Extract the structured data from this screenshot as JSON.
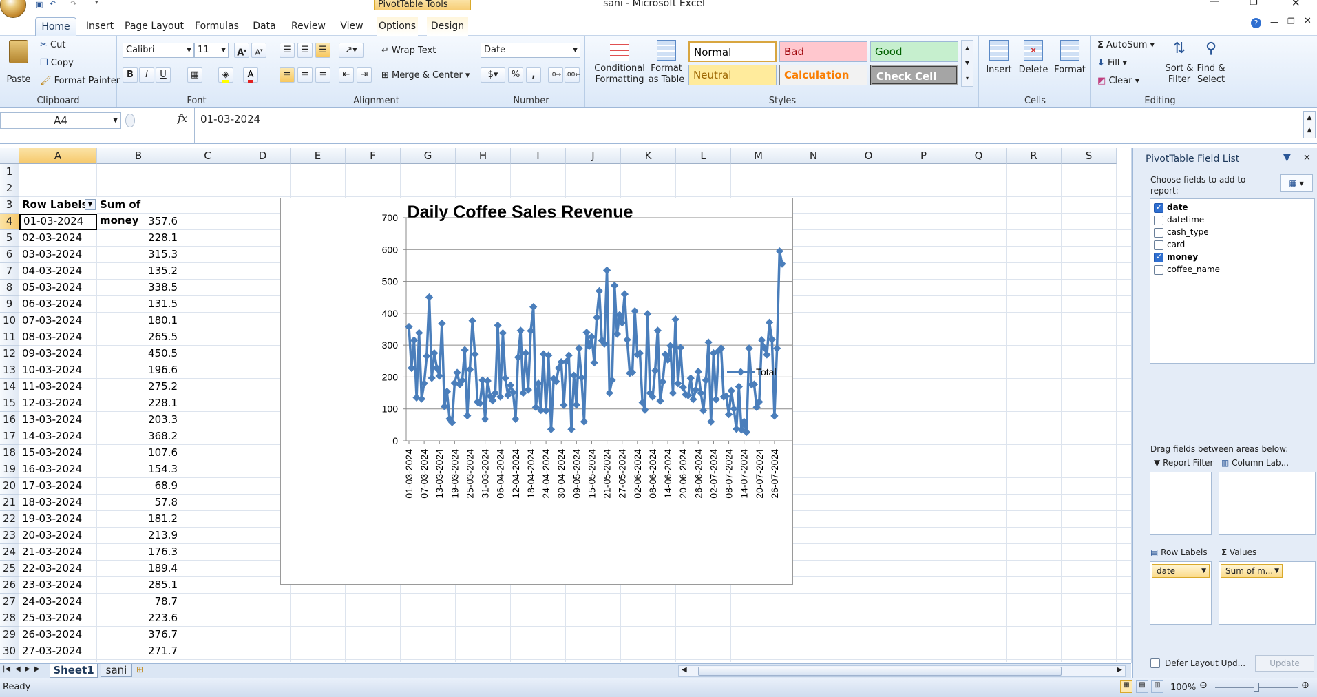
{
  "window": {
    "title": "sani - Microsoft Excel",
    "context_tab": "PivotTable Tools"
  },
  "ribbon": {
    "tabs": [
      "Home",
      "Insert",
      "Page Layout",
      "Formulas",
      "Data",
      "Review",
      "View",
      "Options",
      "Design"
    ],
    "active_tab": "Home",
    "clipboard": {
      "paste": "Paste",
      "cut": "Cut",
      "copy": "Copy",
      "format_painter": "Format Painter",
      "label": "Clipboard"
    },
    "font": {
      "name": "Calibri",
      "size": "11",
      "label": "Font",
      "bold": "B",
      "italic": "I",
      "underline": "U"
    },
    "alignment": {
      "wrap": "Wrap Text",
      "merge": "Merge & Center",
      "label": "Alignment"
    },
    "number": {
      "format": "Date",
      "label": "Number",
      "percent": "%",
      "comma": ","
    },
    "styles": {
      "conditional": "Conditional Formatting",
      "format_as_table": "Format as Table",
      "label": "Styles",
      "cells": [
        {
          "name": "Normal",
          "bg": "#ffffff",
          "fg": "#000000",
          "border": "#d8a640"
        },
        {
          "name": "Bad",
          "bg": "#ffc7ce",
          "fg": "#9c0006",
          "border": "#ffc7ce"
        },
        {
          "name": "Good",
          "bg": "#c6efce",
          "fg": "#006100",
          "border": "#c6efce"
        },
        {
          "name": "Neutral",
          "bg": "#ffeb9c",
          "fg": "#9c6500",
          "border": "#ffeb9c"
        },
        {
          "name": "Calculation",
          "bg": "#f2f2f2",
          "fg": "#fa7d00",
          "border": "#7f7f7f"
        },
        {
          "name": "Check Cell",
          "bg": "#a5a5a5",
          "fg": "#ffffff",
          "border": "#3f3f3f"
        }
      ]
    },
    "cells": {
      "insert": "Insert",
      "delete": "Delete",
      "format": "Format",
      "label": "Cells"
    },
    "editing": {
      "autosum": "AutoSum",
      "fill": "Fill",
      "clear": "Clear",
      "sort": "Sort & Filter",
      "find": "Find & Select",
      "label": "Editing"
    }
  },
  "formula_bar": {
    "name_box": "A4",
    "fx": "fx",
    "value": "01-03-2024"
  },
  "grid": {
    "columns": [
      "A",
      "B",
      "C",
      "D",
      "E",
      "F",
      "G",
      "H",
      "I",
      "J",
      "K",
      "L",
      "M",
      "N",
      "O",
      "P",
      "Q",
      "R",
      "S"
    ],
    "header_a": "Row Labels",
    "header_b": "Sum of money",
    "rows": [
      [
        "01-03-2024",
        "357.6"
      ],
      [
        "02-03-2024",
        "228.1"
      ],
      [
        "03-03-2024",
        "315.3"
      ],
      [
        "04-03-2024",
        "135.2"
      ],
      [
        "05-03-2024",
        "338.5"
      ],
      [
        "06-03-2024",
        "131.5"
      ],
      [
        "07-03-2024",
        "180.1"
      ],
      [
        "08-03-2024",
        "265.5"
      ],
      [
        "09-03-2024",
        "450.5"
      ],
      [
        "10-03-2024",
        "196.6"
      ],
      [
        "11-03-2024",
        "275.2"
      ],
      [
        "12-03-2024",
        "228.1"
      ],
      [
        "13-03-2024",
        "203.3"
      ],
      [
        "14-03-2024",
        "368.2"
      ],
      [
        "15-03-2024",
        "107.6"
      ],
      [
        "16-03-2024",
        "154.3"
      ],
      [
        "17-03-2024",
        "68.9"
      ],
      [
        "18-03-2024",
        "57.8"
      ],
      [
        "19-03-2024",
        "181.2"
      ],
      [
        "20-03-2024",
        "213.9"
      ],
      [
        "21-03-2024",
        "176.3"
      ],
      [
        "22-03-2024",
        "189.4"
      ],
      [
        "23-03-2024",
        "285.1"
      ],
      [
        "24-03-2024",
        "78.7"
      ],
      [
        "25-03-2024",
        "223.6"
      ],
      [
        "26-03-2024",
        "376.7"
      ],
      [
        "27-03-2024",
        "271.7"
      ]
    ]
  },
  "chart_data": {
    "type": "line",
    "title": "Daily Coffee Sales Revenue",
    "series": [
      {
        "name": "Total",
        "color": "#4a7ebb",
        "values": [
          357.6,
          228.1,
          315.3,
          135.2,
          338.5,
          131.5,
          180.1,
          265.5,
          450.5,
          196.6,
          275.2,
          228.1,
          203.3,
          368.2,
          107.6,
          154.3,
          68.9,
          57.8,
          181.2,
          213.9,
          176.3,
          189.4,
          285.1,
          78.7,
          223.6,
          376.7,
          271.7,
          122,
          118,
          190,
          68,
          188,
          140,
          126,
          150,
          362,
          138,
          338,
          196,
          143,
          174,
          152,
          68,
          262,
          346,
          150,
          275,
          160,
          345,
          420,
          105,
          180,
          96,
          272,
          95,
          268,
          36,
          195,
          186,
          228,
          247,
          112,
          248,
          268,
          36,
          205,
          113,
          290,
          198,
          60,
          340,
          297,
          326,
          245,
          387,
          470,
          315,
          304,
          535,
          150,
          190,
          487,
          335,
          395,
          370,
          460,
          317,
          212,
          215,
          407,
          270,
          275,
          120,
          97,
          398,
          150,
          138,
          220,
          346,
          125,
          185,
          271,
          254,
          298,
          150,
          381,
          180,
          292,
          168,
          145,
          142,
          196,
          130,
          160,
          217,
          150,
          95,
          190,
          309,
          60,
          275,
          130,
          282,
          290,
          138,
          140,
          83,
          157,
          100,
          37,
          170,
          35,
          60,
          27,
          290,
          176,
          177,
          105,
          122,
          316,
          292,
          270,
          371,
          318,
          78,
          290,
          595,
          555
        ]
      }
    ],
    "x_tick_labels": [
      "01-03-2024",
      "07-03-2024",
      "13-03-2024",
      "19-03-2024",
      "25-03-2024",
      "31-03-2024",
      "06-04-2024",
      "12-04-2024",
      "18-04-2024",
      "24-04-2024",
      "30-04-2024",
      "09-05-2024",
      "15-05-2024",
      "21-05-2024",
      "27-05-2024",
      "02-06-2024",
      "08-06-2024",
      "14-06-2024",
      "20-06-2024",
      "26-06-2024",
      "02-07-2024",
      "08-07-2024",
      "14-07-2024",
      "20-07-2024",
      "26-07-2024"
    ],
    "y_ticks": [
      "0",
      "100",
      "200",
      "300",
      "400",
      "500",
      "600",
      "700"
    ],
    "ylim": [
      0,
      700
    ],
    "legend": "right",
    "grid": true
  },
  "sheets": {
    "tabs": [
      "Sheet1",
      "sani"
    ],
    "active": "Sheet1"
  },
  "status": {
    "ready": "Ready",
    "zoom": "100%"
  },
  "pivot_pane": {
    "title": "PivotTable Field List",
    "choose": "Choose fields to add to report:",
    "fields": [
      {
        "name": "date",
        "checked": true
      },
      {
        "name": "datetime",
        "checked": false
      },
      {
        "name": "cash_type",
        "checked": false
      },
      {
        "name": "card",
        "checked": false
      },
      {
        "name": "money",
        "checked": true
      },
      {
        "name": "coffee_name",
        "checked": false
      }
    ],
    "drag_label": "Drag fields between areas below:",
    "report_filter": "Report Filter",
    "column_labels": "Column Lab...",
    "row_labels": "Row Labels",
    "values": "Values",
    "row_item": "date",
    "value_item": "Sum of m...",
    "defer": "Defer Layout Upd...",
    "update": "Update"
  }
}
